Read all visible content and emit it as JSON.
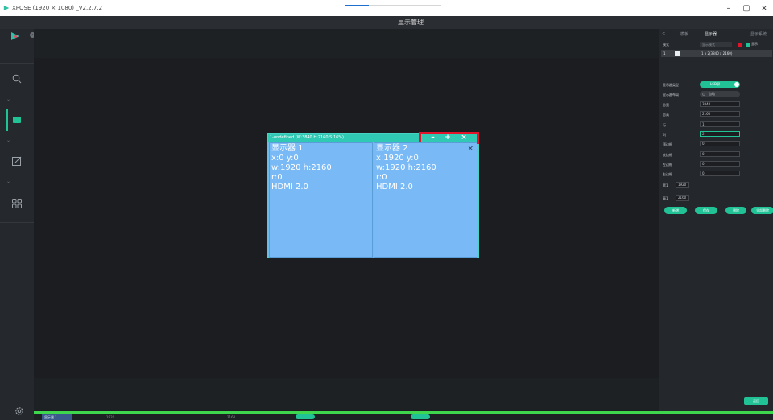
{
  "window": {
    "title": "XPOSE (1920 × 1080) _V2.2.7.2",
    "controls": [
      "–",
      "▢",
      "×"
    ]
  },
  "header": {
    "title": "显示管理"
  },
  "colors": {
    "accent": "#21c296",
    "highlight": "#e2142b",
    "screen": "#79b9f6",
    "green_bar": "#3ed64d"
  },
  "sidebar": {
    "items": [
      {
        "icon": "search-icon"
      },
      {
        "icon": "display-icon",
        "active": true
      },
      {
        "icon": "edit-icon"
      },
      {
        "icon": "grid-icon"
      }
    ],
    "footer_icon": "gear-icon"
  },
  "display_window": {
    "title": "1-undefined  (W:3840 H:2160 S:16%)",
    "controls": {
      "minimize": "–",
      "maximize": "+",
      "close": "×"
    },
    "screens": [
      {
        "name": "显示器 1",
        "pos": "x:0  y:0",
        "size": "w:1920  h:2160",
        "rotation": "r:0",
        "port": "HDMI 2.0"
      },
      {
        "name": "显示器 2",
        "pos": "x:1920  y:0",
        "size": "w:1920  h:2160",
        "rotation": "r:0",
        "port": "HDMI 2.0",
        "close": "×"
      }
    ]
  },
  "right_panel": {
    "back": "<",
    "tabs": [
      "模板",
      "显示器",
      "显示系统"
    ],
    "mode_label": "模式",
    "mode_select": "显示模式",
    "checkbox_label": "显示",
    "list_row": {
      "index": "1",
      "text": "1 x 2(3840 x 2160)"
    },
    "fields": [
      {
        "label": "显示器类型"
      },
      {
        "label": "显示器布局"
      },
      {
        "label": "总宽",
        "value": "3840"
      },
      {
        "label": "总高",
        "value": "2160"
      },
      {
        "label": "行",
        "value": "1"
      },
      {
        "label": "列",
        "value": "2"
      },
      {
        "label": "顶边框",
        "value": "0"
      },
      {
        "label": "底边框",
        "value": "0"
      },
      {
        "label": "左边框",
        "value": "0"
      },
      {
        "label": "右边框",
        "value": "0"
      }
    ],
    "toggle_label": "LCD屏",
    "auto_label": "自动",
    "width_label": "宽1",
    "width_value": "1920",
    "height_label": "高1",
    "height_value": "2160",
    "buttons": [
      "新增",
      "保存",
      "删除",
      "全部删除"
    ],
    "back_button": "返回"
  },
  "bottom_bar": {
    "active_tab": "显示器 1",
    "labels": [
      "1920",
      "2160"
    ]
  }
}
